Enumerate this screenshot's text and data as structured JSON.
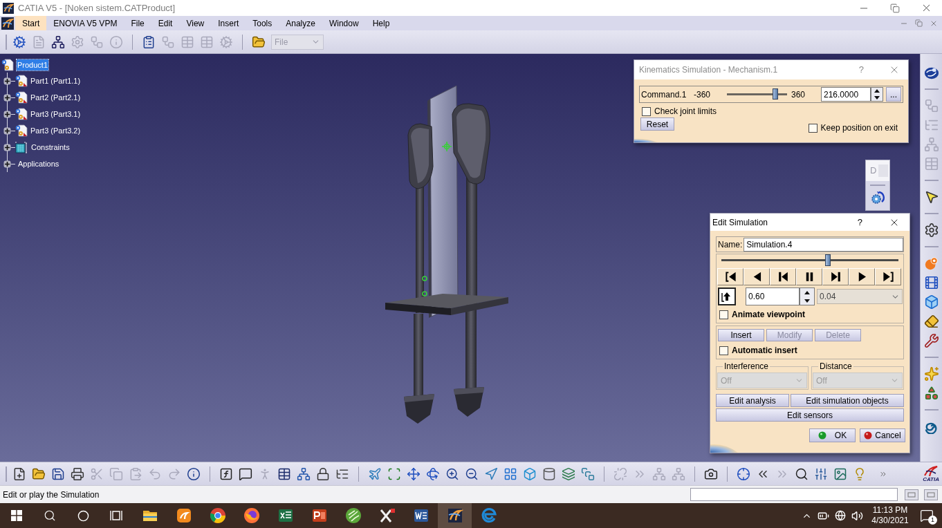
{
  "window": {
    "title": "CATIA V5 - [Noken sistem.CATProduct]"
  },
  "menu": [
    {
      "label": "Start",
      "selected": true
    },
    {
      "label": "ENOVIA V5 VPM",
      "selected": false
    },
    {
      "label": "File",
      "selected": false
    },
    {
      "label": "Edit",
      "selected": false
    },
    {
      "label": "View",
      "selected": false
    },
    {
      "label": "Insert",
      "selected": false
    },
    {
      "label": "Tools",
      "selected": false
    },
    {
      "label": "Analyze",
      "selected": false
    },
    {
      "label": "Window",
      "selected": false
    },
    {
      "label": "Help",
      "selected": false
    }
  ],
  "top_toolbar": {
    "tools": [
      {
        "disabled": false
      },
      {
        "disabled": true
      },
      {
        "disabled": false
      },
      {
        "disabled": true
      },
      {
        "disabled": true
      },
      {
        "disabled": true
      },
      {
        "disabled": false
      },
      {
        "disabled": true
      },
      {
        "disabled": true
      },
      {
        "disabled": true
      },
      {
        "disabled": true
      },
      {
        "disabled": false
      }
    ],
    "file_dropdown": {
      "value": "File",
      "disabled": true
    }
  },
  "tree": {
    "label": "Product1",
    "selected": true,
    "children": [
      {
        "kind": "part",
        "label": "Part1 (Part1.1)",
        "selected": false,
        "expanded": false
      },
      {
        "kind": "part",
        "label": "Part2 (Part2.1)",
        "selected": false,
        "expanded": false
      },
      {
        "kind": "part",
        "label": "Part3 (Part3.1)",
        "selected": false,
        "expanded": false
      },
      {
        "kind": "part",
        "label": "Part3 (Part3.2)",
        "selected": false,
        "expanded": false
      },
      {
        "kind": "constraints",
        "label": "Constraints",
        "selected": false,
        "expanded": false
      },
      {
        "kind": "applications",
        "label": "Applications",
        "selected": false,
        "expanded": false
      }
    ]
  },
  "kinematics_dialog": {
    "title": "Kinematics Simulation - Mechanism.1",
    "help_button": "?",
    "command": {
      "label": "Command.1",
      "min": "-360",
      "max": "360",
      "level": 0.8,
      "value": "216.0000"
    },
    "more_button": "...",
    "check_joint_limits": {
      "label": "Check joint limits",
      "checked": false
    },
    "reset_button": "Reset",
    "keep_position": {
      "label": "Keep position on exit",
      "checked": false
    }
  },
  "floating_toolbar": {
    "title": "D"
  },
  "simulation_dialog": {
    "title": "Edit Simulation",
    "help_button": "?",
    "name_label": "Name:",
    "name_value": "Simulation.4",
    "timeline": {
      "level": 0.6
    },
    "step_value": "0.60",
    "step_dropdown": "0.04",
    "animate_viewpoint": {
      "label": "Animate viewpoint",
      "checked": false
    },
    "edit_buttons": [
      {
        "label": "Insert",
        "disabled": false
      },
      {
        "label": "Modify",
        "disabled": true
      },
      {
        "label": "Delete",
        "disabled": true
      }
    ],
    "automatic_insert": {
      "label": "Automatic insert",
      "checked": false
    },
    "analysis": [
      {
        "label": "Interference",
        "value": "Off",
        "disabled": true
      },
      {
        "label": "Distance",
        "value": "Off",
        "disabled": true
      }
    ],
    "action_buttons": [
      "Edit analysis",
      "Edit simulation objects"
    ],
    "sensors_button": "Edit sensors",
    "ok_button": "OK",
    "cancel_button": "Cancel"
  },
  "right_toolbar": [
    {
      "disabled": false
    },
    {
      "disabled": true
    },
    {
      "disabled": true
    },
    {
      "disabled": true
    },
    {
      "disabled": true
    },
    {
      "disabled": false
    },
    {
      "disabled": false
    },
    {
      "disabled": false
    },
    {
      "disabled": false
    },
    {
      "disabled": false
    },
    {
      "disabled": false
    },
    {
      "disabled": false
    },
    {
      "disabled": false
    },
    {
      "disabled": false
    },
    {
      "disabled": false
    }
  ],
  "bottom_toolbar": [
    {
      "disabled": false
    },
    {
      "disabled": false
    },
    {
      "disabled": false
    },
    {
      "disabled": false
    },
    {
      "disabled": true
    },
    {
      "disabled": true
    },
    {
      "disabled": true
    },
    {
      "disabled": true
    },
    {
      "disabled": true
    },
    {
      "disabled": false
    },
    {
      "disabled": false
    },
    {
      "disabled": false
    },
    {
      "disabled": true
    },
    {
      "disabled": false
    },
    {
      "disabled": false
    },
    {
      "disabled": false
    },
    {
      "disabled": false
    },
    {
      "disabled": false
    },
    {
      "disabled": false
    },
    {
      "disabled": false
    },
    {
      "disabled": false
    },
    {
      "disabled": false
    },
    {
      "disabled": false
    },
    {
      "disabled": false
    },
    {
      "disabled": false
    },
    {
      "disabled": false
    },
    {
      "disabled": false
    },
    {
      "disabled": false
    },
    {
      "disabled": false
    },
    {
      "disabled": true
    },
    {
      "disabled": true
    },
    {
      "disabled": true
    },
    {
      "disabled": true
    },
    {
      "disabled": false
    },
    {
      "disabled": false
    },
    {
      "disabled": false
    },
    {
      "disabled": true
    },
    {
      "disabled": false
    },
    {
      "disabled": false
    },
    {
      "disabled": false
    },
    {
      "disabled": false
    }
  ],
  "brand_logo": {
    "text": "CATIA"
  },
  "status_bar": {
    "message": "Edit or play the Simulation"
  },
  "taskbar": {
    "apps": [
      {
        "selected": false
      },
      {
        "selected": false
      },
      {
        "selected": false
      },
      {
        "selected": false
      },
      {
        "selected": false
      },
      {
        "selected": false
      },
      {
        "selected": false
      },
      {
        "selected": false
      },
      {
        "selected": false
      },
      {
        "selected": true
      },
      {
        "selected": false
      }
    ],
    "time": "11:13 PM",
    "date": "4/30/2021",
    "notification_count": "1"
  }
}
